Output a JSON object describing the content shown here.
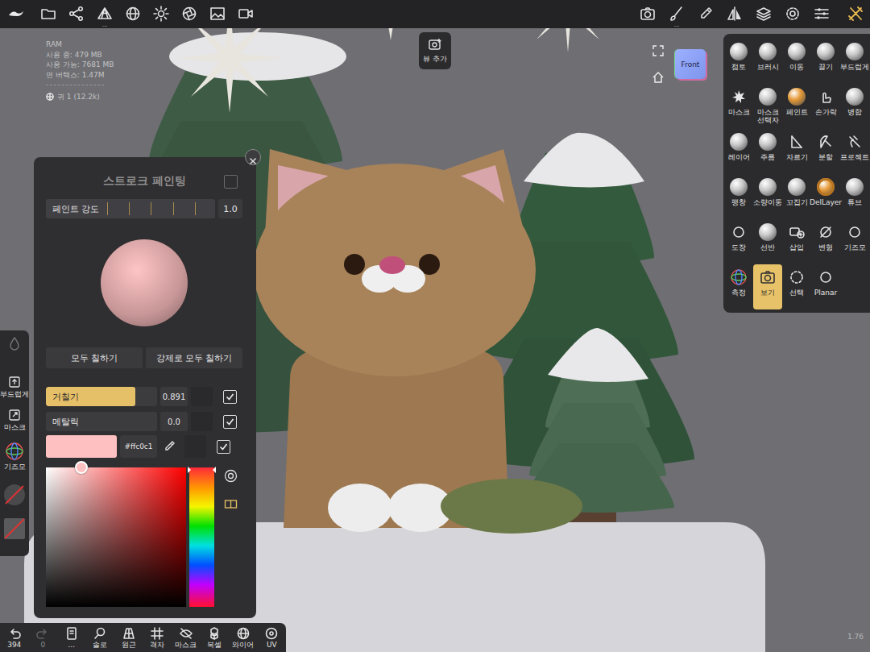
{
  "stats": {
    "lines": [
      "RAM",
      "사용 중: 479 MB",
      "사용 가능: 7681 MB",
      "면 버텍스: 1.47M"
    ],
    "object": "귀 1 (12.2k)"
  },
  "top_bar": {
    "menu_marks": [
      {
        "label": "..."
      },
      {
        "label": "..."
      }
    ]
  },
  "add_view": {
    "label": "뷰 추가"
  },
  "view_cube": {
    "label": "Front"
  },
  "tools": [
    {
      "label": "점토",
      "selected": false
    },
    {
      "label": "브러시",
      "selected": false
    },
    {
      "label": "이동",
      "selected": false
    },
    {
      "label": "끌기",
      "selected": false
    },
    {
      "label": "부드럽게",
      "selected": false
    },
    {
      "label": "마스크",
      "selected": false
    },
    {
      "label": "마스크 선택자",
      "selected": false
    },
    {
      "label": "페인트",
      "selected": false
    },
    {
      "label": "손가락",
      "selected": false
    },
    {
      "label": "병합",
      "selected": false
    },
    {
      "label": "레이어",
      "selected": false
    },
    {
      "label": "주름",
      "selected": false
    },
    {
      "label": "자르기",
      "selected": false
    },
    {
      "label": "분할",
      "selected": false
    },
    {
      "label": "프로젝트",
      "selected": false
    },
    {
      "label": "팽창",
      "selected": false
    },
    {
      "label": "소량이동",
      "selected": false
    },
    {
      "label": "꼬집기",
      "selected": false
    },
    {
      "label": "DelLayer",
      "selected": false
    },
    {
      "label": "튜브",
      "selected": false
    },
    {
      "label": "도장",
      "selected": false
    },
    {
      "label": "선반",
      "selected": false
    },
    {
      "label": "삽입",
      "selected": false
    },
    {
      "label": "변형",
      "selected": false
    },
    {
      "label": "기즈모",
      "selected": false
    },
    {
      "label": "측정",
      "selected": false
    },
    {
      "label": "보기",
      "selected": true
    },
    {
      "label": "선택",
      "selected": false
    },
    {
      "label": "Planar",
      "selected": false
    }
  ],
  "side_tools": [
    {
      "label": "부드럽게"
    },
    {
      "label": "마스크"
    },
    {
      "label": "기즈모"
    }
  ],
  "bottom_bar": [
    {
      "label": "394",
      "disabled": false
    },
    {
      "label": "0",
      "disabled": true
    },
    {
      "label": "...",
      "disabled": false
    },
    {
      "label": "솔로",
      "disabled": false
    },
    {
      "label": "원근",
      "disabled": false
    },
    {
      "label": "격자",
      "disabled": false
    },
    {
      "label": "마스크",
      "disabled": false
    },
    {
      "label": "복셀",
      "disabled": false
    },
    {
      "label": "와이어",
      "disabled": false
    },
    {
      "label": "UV",
      "disabled": false
    }
  ],
  "panel": {
    "title": "스트로크 페인팅",
    "enabled": false,
    "strength": {
      "label": "페인트 강도",
      "level": 1.0,
      "value": "1.0"
    },
    "buttons": [
      "모두 칠하기",
      "강제로 모두 칠하기"
    ],
    "materials": [
      {
        "kind": "slider",
        "label": "거칠기",
        "level": 0.891,
        "value": "0.891",
        "checked": true
      },
      {
        "kind": "slider",
        "label": "메탈릭",
        "level": 0.0,
        "value": "0.0",
        "checked": true
      },
      {
        "kind": "color",
        "color": "#ffc0c1",
        "value": "#ffc0c1",
        "checked": true
      }
    ],
    "picker": {
      "hue": 0.0,
      "saturation": 0.25,
      "brightness": 1.0
    }
  },
  "zoom": "1.76"
}
